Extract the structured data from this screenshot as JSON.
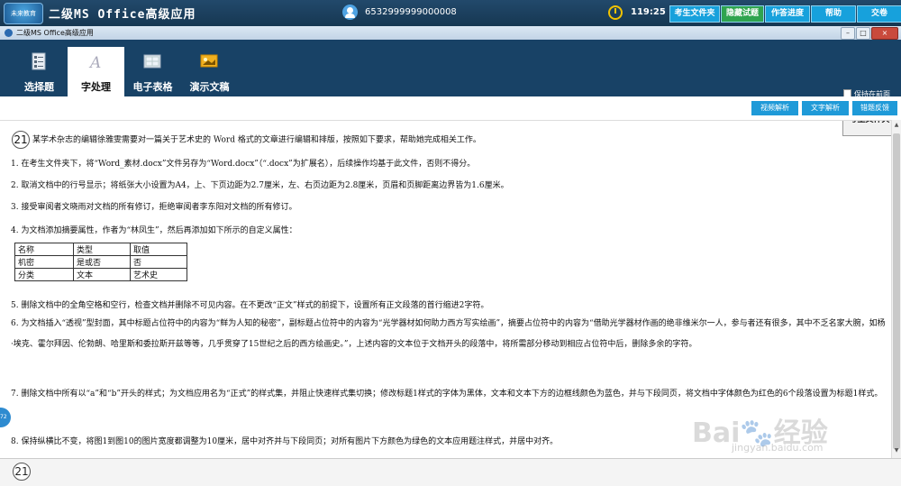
{
  "topbar": {
    "logo_text": "未来教育",
    "app_title": "二级MS Office高级应用",
    "user_id": "6532999999000008",
    "timer": "119:25",
    "buttons": [
      "考生文件夹",
      "隐藏试题",
      "作答进度",
      "帮助",
      "交卷"
    ]
  },
  "window": {
    "title": "二级MS Office高级应用",
    "controls": [
      "–",
      "□",
      "×"
    ]
  },
  "modules": [
    {
      "label": "选择题",
      "icon": "checklist-icon",
      "active": false
    },
    {
      "label": "字处理",
      "icon": "word-document-icon",
      "active": true
    },
    {
      "label": "电子表格",
      "icon": "spreadsheet-icon",
      "active": false
    },
    {
      "label": "演示文稿",
      "icon": "slideshow-icon",
      "active": false
    }
  ],
  "keep_front_label": "保持在前面",
  "folder_button": "考生文件夹",
  "analysis_buttons": [
    "视频解析",
    "文字解析",
    "错题反馈"
  ],
  "question": {
    "number": "21",
    "intro": "某学术杂志的编辑徐雅雯需要对一篇关于艺术史的 Word 格式的文章进行编辑和排版，按照如下要求，帮助她完成相关工作。",
    "items": [
      "1. 在考生文件夹下，将“Word_素材.docx”文件另存为“Word.docx”（“.docx”为扩展名），后续操作均基于此文件，否则不得分。",
      "2. 取消文档中的行号显示；将纸张大小设置为A4，上、下页边距为2.7厘米，左、右页边距为2.8厘米，页眉和页脚距离边界皆为1.6厘米。",
      "3. 接受审阅者文晓雨对文档的所有修订，拒绝审阅者李东阳对文档的所有修订。",
      "4. 为文档添加摘要属性，作者为“林凤生”，然后再添加如下所示的自定义属性："
    ],
    "table": [
      [
        "名称",
        "类型",
        "取值"
      ],
      [
        "机密",
        "是或否",
        "否"
      ],
      [
        "分类",
        "文本",
        "艺术史"
      ]
    ],
    "item5": "5. 删除文档中的全角空格和空行，检查文档并删除不可见内容。在不更改“正文”样式的前提下，设置所有正文段落的首行缩进2字符。",
    "item6": "6. 为文档插入“透视”型封面，其中标题占位符中的内容为“鲜为人知的秘密”，副标题占位符中的内容为“光学器材如何助力西方写实绘画”，摘要占位符中的内容为“借助光学器材作画的绝非维米尔一人，参与者还有很多，其中不乏名家大腕，如杨·凡·埃克、霍尔拜因、伦勃朗、哈里斯和委拉斯开兹等等，几乎贯穿了15世纪之后的西方绘画史。”，上述内容的文本位于文档开头的段落中，将所需部分移动到相应占位符中后，删除多余的字符。",
    "item7": "7. 删除文档中所有以“a”和“b”开头的样式；为文档应用名为“正式”的样式集，并阻止快速样式集切换；修改标题1样式的字体为黑体，文本和文本下方的边框线颜色为蓝色，并与下段同页，将文档中字体颜色为红色的6个段落设置为标题1样式。",
    "item8": "8. 保持纵横比不变，将图1到图10的图片宽度都调整为10厘米，居中对齐并与下段同页；对所有图片下方颜色为绿色的文本应用题注样式，并居中对齐。"
  },
  "bottom_number": "21",
  "watermark": {
    "text": "Bai🐾经验",
    "url": "jingyan.baidu.com",
    "side_badge": "72"
  }
}
